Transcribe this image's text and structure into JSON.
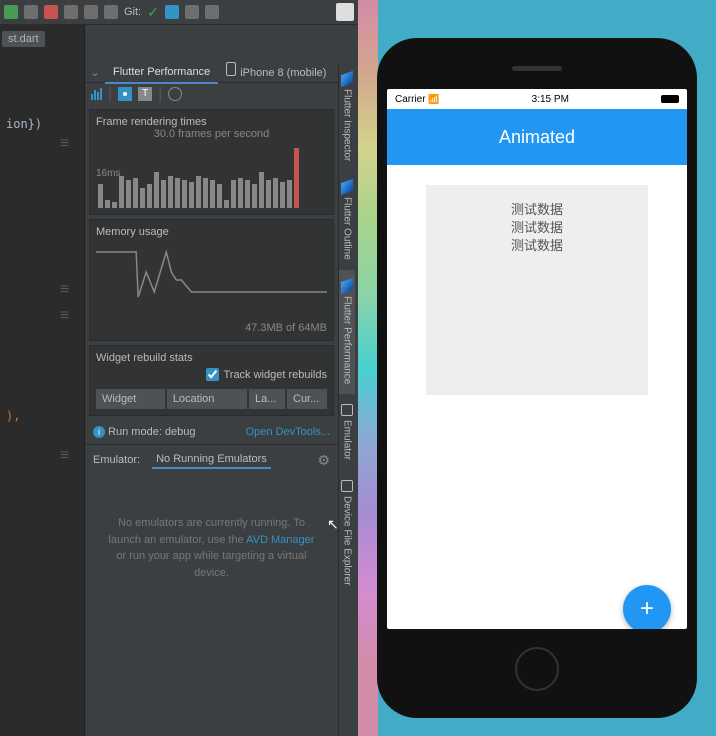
{
  "toolbar": {
    "git_label": "Git:"
  },
  "leftGutter": {
    "file_tab": "st.dart",
    "code_frag": "ion})",
    "code_brace": "),"
  },
  "panel": {
    "tabs": {
      "performance": "Flutter Performance",
      "device": "iPhone 8 (mobile)"
    },
    "frame": {
      "title": "Frame rendering times",
      "fps": "30.0 frames per second",
      "label16": "16ms"
    },
    "memory": {
      "title": "Memory usage",
      "usage": "47.3MB of 64MB"
    },
    "widgets": {
      "title": "Widget rebuild stats",
      "track_label": "Track widget rebuilds",
      "cols": {
        "widget": "Widget",
        "location": "Location",
        "la": "La...",
        "cur": "Cur..."
      }
    },
    "run_mode": {
      "text": "Run mode: debug",
      "devtools": "Open DevTools..."
    },
    "emulator": {
      "label": "Emulator:",
      "tab": "No Running Emulators",
      "empty1": "No emulators are currently running. To launch an emulator, use the",
      "link": "AVD Manager",
      "empty2": "or run your app while targeting a virtual device."
    }
  },
  "rail": {
    "inspector": "Flutter Inspector",
    "outline": "Flutter Outline",
    "performance": "Flutter Performance",
    "emulator": "Emulator",
    "explorer": "Device File Explorer"
  },
  "sim": {
    "carrier": "Carrier",
    "time": "3:15 PM",
    "app_title": "Animated",
    "items": [
      "测试数据",
      "测试数据",
      "测试数据"
    ]
  },
  "chart_data": {
    "type": "bar",
    "title": "Frame rendering times",
    "ylabel": "ms",
    "ylim": [
      0,
      30
    ],
    "threshold": 16,
    "values": [
      12,
      4,
      3,
      16,
      14,
      15,
      10,
      12,
      18,
      14,
      16,
      15,
      14,
      13,
      16,
      15,
      14,
      12,
      4,
      14,
      15,
      14,
      12,
      18,
      14,
      15,
      13,
      14,
      30
    ]
  }
}
